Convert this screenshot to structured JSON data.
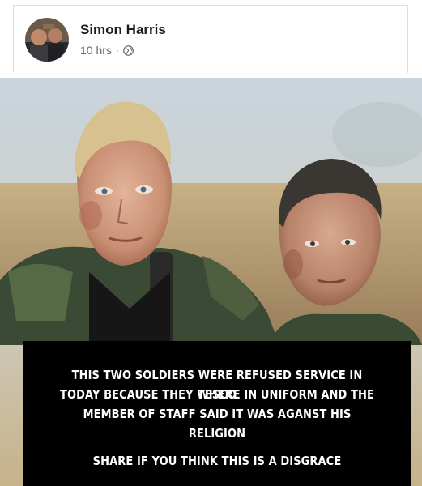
{
  "post": {
    "author": "Simon Harris",
    "time": "10 hrs",
    "separator": "·",
    "audience_icon": "globe-icon"
  },
  "image": {
    "caption_lines": [
      "THIS TWO SOLDIERS WERE REFUSED SERVICE IN TESCO",
      "TODAY BECAUSE THEY WHERE IN UNIFORM AND THE",
      "MEMBER OF STAFF SAID IT WAS AGANST HIS RELIGION"
    ],
    "cta": "SHARE IF YOU THINK THIS IS A DISGRACE"
  },
  "colors": {
    "author_text": "#1c1e21",
    "meta_text": "#606770",
    "caption_bg": "#000000",
    "caption_text": "#ffffff"
  }
}
